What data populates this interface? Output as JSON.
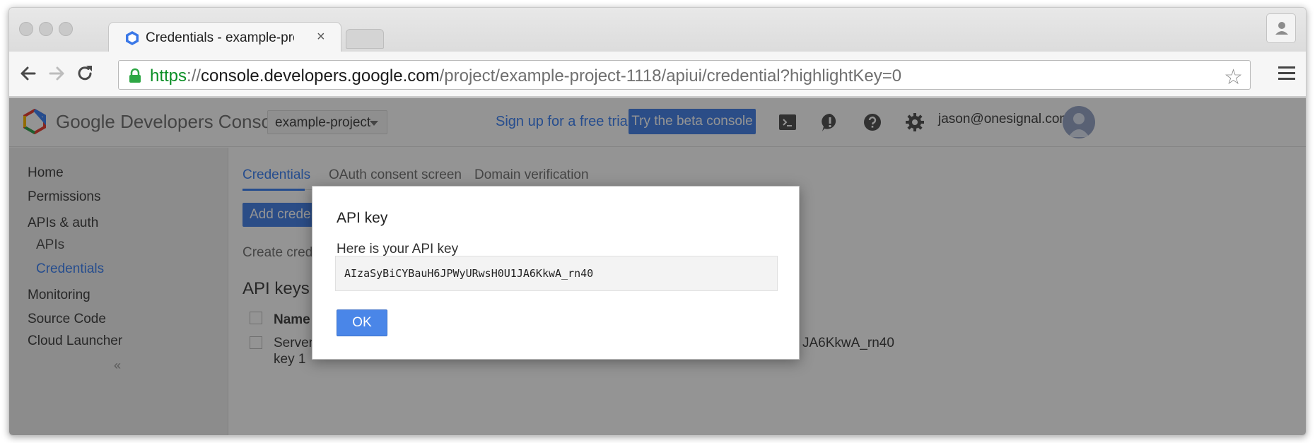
{
  "browser": {
    "tab_title": "Credentials - example-project",
    "tab_close": "×",
    "url_scheme": "https",
    "url_sep": "://",
    "url_host": "console.developers.google.com",
    "url_path": "/project/example-project-1118/apiui/credential?highlightKey=0",
    "bookmark_star": "☆"
  },
  "header": {
    "product_name": "Google Developers Console",
    "project_name": "example-project",
    "signup_link": "Sign up for a free trial.",
    "beta_button": "Try the beta console",
    "user_email": "jason@onesignal.com"
  },
  "sidebar": {
    "items": [
      {
        "label": "Home"
      },
      {
        "label": "Permissions"
      },
      {
        "label": "APIs & auth"
      },
      {
        "label": "APIs"
      },
      {
        "label": "Credentials"
      },
      {
        "label": "Monitoring"
      },
      {
        "label": "Source Code"
      },
      {
        "label": "Cloud Launcher"
      }
    ],
    "collapse_label": "«"
  },
  "content": {
    "tabs": [
      {
        "label": "Credentials"
      },
      {
        "label": "OAuth consent screen"
      },
      {
        "label": "Domain verification"
      }
    ],
    "add_credentials_button": "Add credentials",
    "create_text": "Create credentials",
    "api_keys_heading": "API keys",
    "table": {
      "header_name": "Name",
      "row_name_line1": "Server",
      "row_name_line2": "key 1",
      "row_key_suffix": "JA6KkwA_rn40"
    }
  },
  "dialog": {
    "title": "API key",
    "subtitle": "Here is your API key",
    "api_key": "AIzaSyBiCYBauH6JPWyURwsH0U1JA6KkwA_rn40",
    "ok_button": "OK"
  },
  "colors": {
    "accent": "#4285f4",
    "button_blue": "#4a86e8",
    "secure_green": "#0b8f26"
  }
}
